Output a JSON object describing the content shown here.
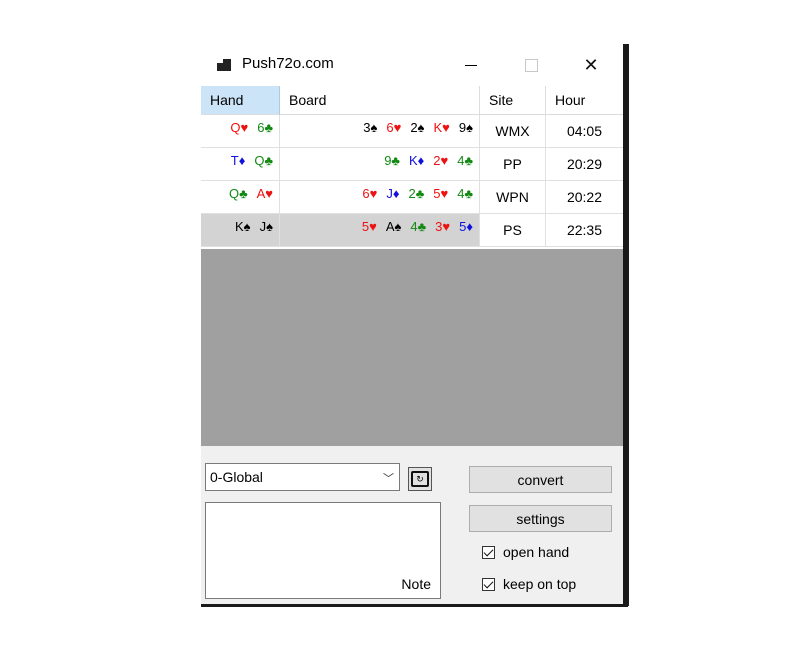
{
  "window": {
    "title": "Push72o.com"
  },
  "titlebar": {
    "close_symbol": "✕"
  },
  "table": {
    "headers": {
      "hand": "Hand",
      "board": "Board",
      "site": "Site",
      "hour": "Hour"
    },
    "rows": [
      {
        "hand": [
          {
            "t": "Q♥",
            "c": "red"
          },
          {
            "t": "6♣",
            "c": "green"
          }
        ],
        "board": [
          {
            "t": "3♠",
            "c": "black"
          },
          {
            "t": "6♥",
            "c": "red"
          },
          {
            "t": "2♠",
            "c": "black"
          },
          {
            "t": "K♥",
            "c": "red"
          },
          {
            "t": "9♠",
            "c": "black"
          }
        ],
        "site": "WMX",
        "hour": "04:05"
      },
      {
        "hand": [
          {
            "t": "T♦",
            "c": "blue"
          },
          {
            "t": "Q♣",
            "c": "green"
          }
        ],
        "board": [
          {
            "t": "9♣",
            "c": "green"
          },
          {
            "t": "K♦",
            "c": "blue"
          },
          {
            "t": "2♥",
            "c": "red"
          },
          {
            "t": "4♣",
            "c": "green"
          }
        ],
        "site": "PP",
        "hour": "20:29"
      },
      {
        "hand": [
          {
            "t": "Q♣",
            "c": "green"
          },
          {
            "t": "A♥",
            "c": "red"
          }
        ],
        "board": [
          {
            "t": "6♥",
            "c": "red"
          },
          {
            "t": "J♦",
            "c": "blue"
          },
          {
            "t": "2♣",
            "c": "green"
          },
          {
            "t": "5♥",
            "c": "red"
          },
          {
            "t": "4♣",
            "c": "green"
          }
        ],
        "site": "WPN",
        "hour": "20:22"
      },
      {
        "hand": [
          {
            "t": "K♠",
            "c": "black"
          },
          {
            "t": "J♠",
            "c": "black"
          }
        ],
        "board": [
          {
            "t": "5♥",
            "c": "red"
          },
          {
            "t": "A♠",
            "c": "black"
          },
          {
            "t": "4♣",
            "c": "green"
          },
          {
            "t": "3♥",
            "c": "red"
          },
          {
            "t": "5♦",
            "c": "blue"
          }
        ],
        "site": "PS",
        "hour": "22:35",
        "selected": true
      }
    ]
  },
  "controls": {
    "profile_selected": "0-Global",
    "note_label": "Note",
    "convert_label": "convert",
    "settings_label": "settings",
    "open_hand_label": "open hand",
    "keep_on_top_label": "keep on top"
  }
}
